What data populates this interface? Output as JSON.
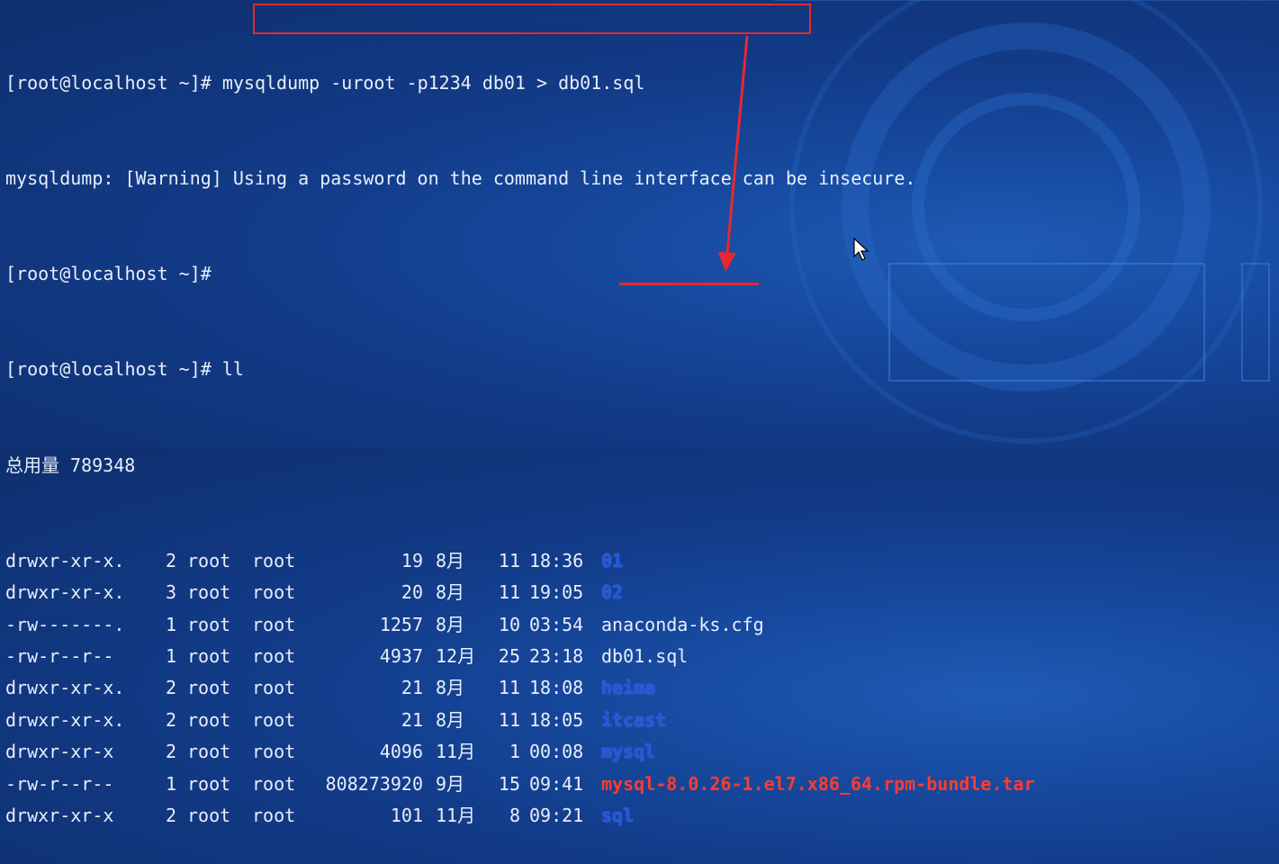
{
  "prompt": "[root@localhost ~]#",
  "command1": "mysqldump -uroot -p1234 db01 > db01.sql",
  "warning": "mysqldump: [Warning] Using a password on the command line interface can be insecure.",
  "command2": "ll",
  "total": "总用量 789348",
  "files": [
    {
      "perm": "drwxr-xr-x.",
      "links": "2",
      "owner": "root",
      "group": "root",
      "size": "19",
      "month": "8月",
      "day": "11",
      "time": "18:36",
      "name": "01",
      "kind": "dir"
    },
    {
      "perm": "drwxr-xr-x.",
      "links": "3",
      "owner": "root",
      "group": "root",
      "size": "20",
      "month": "8月",
      "day": "11",
      "time": "19:05",
      "name": "02",
      "kind": "dir"
    },
    {
      "perm": "-rw-------.",
      "links": "1",
      "owner": "root",
      "group": "root",
      "size": "1257",
      "month": "8月",
      "day": "10",
      "time": "03:54",
      "name": "anaconda-ks.cfg",
      "kind": "plain"
    },
    {
      "perm": "-rw-r--r--",
      "links": "1",
      "owner": "root",
      "group": "root",
      "size": "4937",
      "month": "12月",
      "day": "25",
      "time": "23:18",
      "name": "db01.sql",
      "kind": "plain"
    },
    {
      "perm": "drwxr-xr-x.",
      "links": "2",
      "owner": "root",
      "group": "root",
      "size": "21",
      "month": "8月",
      "day": "11",
      "time": "18:08",
      "name": "heima",
      "kind": "dir"
    },
    {
      "perm": "drwxr-xr-x.",
      "links": "2",
      "owner": "root",
      "group": "root",
      "size": "21",
      "month": "8月",
      "day": "11",
      "time": "18:05",
      "name": "itcast",
      "kind": "dir"
    },
    {
      "perm": "drwxr-xr-x",
      "links": "2",
      "owner": "root",
      "group": "root",
      "size": "4096",
      "month": "11月",
      "day": "1",
      "time": "00:08",
      "name": "mysql",
      "kind": "dir"
    },
    {
      "perm": "-rw-r--r--",
      "links": "1",
      "owner": "root",
      "group": "root",
      "size": "808273920",
      "month": "9月",
      "day": "15",
      "time": "09:41",
      "name": "mysql-8.0.26-1.el7.x86_64.rpm-bundle.tar",
      "kind": "pkg"
    },
    {
      "perm": "drwxr-xr-x",
      "links": "2",
      "owner": "root",
      "group": "root",
      "size": "101",
      "month": "11月",
      "day": "8",
      "time": "09:21",
      "name": "sql",
      "kind": "dir"
    }
  ],
  "colors": {
    "annotation": "#e8282e",
    "directory": "#2256e0",
    "archive": "#ff3b2f",
    "text": "#e8eefc"
  },
  "icons": {
    "cursor": "mouse-pointer-icon"
  }
}
